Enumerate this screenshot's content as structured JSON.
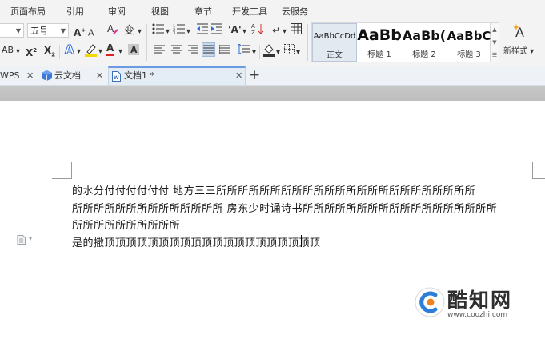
{
  "menu": {
    "items": [
      "页面布局",
      "引用",
      "审阅",
      "视图",
      "章节",
      "开发工具",
      "云服务"
    ]
  },
  "ribbon": {
    "font_size": "五号",
    "styles": [
      {
        "preview": "AaBbCcDd",
        "name": "正文"
      },
      {
        "preview": "AaBb",
        "name": "标题 1"
      },
      {
        "preview": "AaBb(",
        "name": "标题 2"
      },
      {
        "preview": "AaBbC",
        "name": "标题 3"
      }
    ],
    "new_style": "新样式"
  },
  "tabs": [
    {
      "label": "WPS"
    },
    {
      "label": "云文档"
    },
    {
      "label": "文档1 *"
    }
  ],
  "document": {
    "lines": [
      "的水分付付付付付付    地方三三所所所所所所所所所所所所所所所所所所所所所所所所",
      "所所所所所所所所所所所所所所  房东少时诵诗书所所所所所所所所所所所所所所所所所所",
      "所所所所所所所所所所",
      "是的撒顶顶顶顶顶顶顶顶顶顶顶顶顶顶顶顶顶顶顶顶"
    ]
  },
  "watermark": {
    "title": "酷知网",
    "url": "www.coozhi.com"
  },
  "colors": {
    "accent": "#6a9be0",
    "font_color_red": "#e02020",
    "highlight_yellow": "#f5d800",
    "font_color_blue": "#1f4fd8"
  }
}
